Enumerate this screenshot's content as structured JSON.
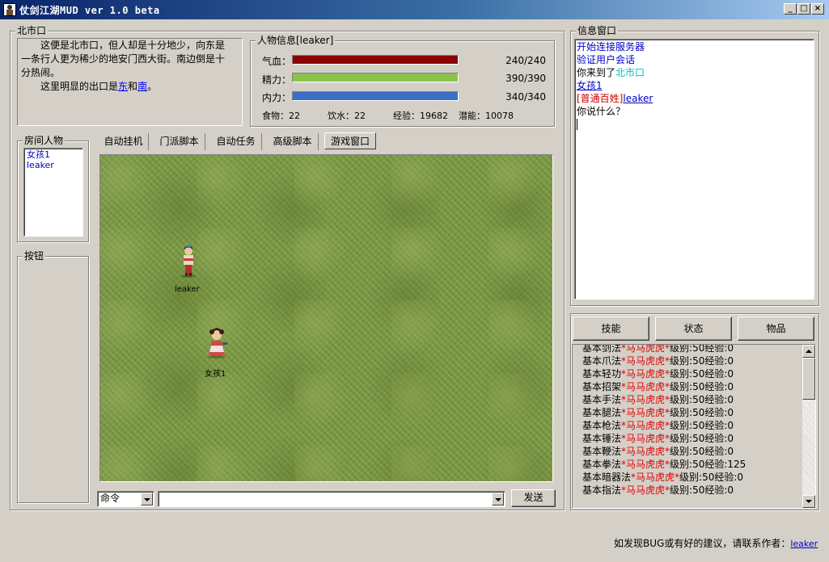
{
  "window": {
    "title": "仗剑江湖MUD ver 1.0 beta",
    "controls": {
      "minimize": "_",
      "maximize": "□",
      "close": "×"
    }
  },
  "location": {
    "title": "北市口",
    "desc_line1": "这便是北市口，但人却是十分地少，向东是一条行人更为稀少的地安门西大街。南边倒是十分热闹。",
    "exits_prefix": "这里明显的出口是",
    "exit_east": "东",
    "exits_and": "和",
    "exit_south": "南",
    "exits_suffix": "。"
  },
  "player_info": {
    "title": "人物信息[leaker]",
    "stats": [
      {
        "label": "气血：",
        "value": "240/240",
        "fill": 1.0,
        "color": "#8b0000"
      },
      {
        "label": "精力：",
        "value": "390/390",
        "fill": 1.0,
        "color": "#8bc34a"
      },
      {
        "label": "内力：",
        "value": "340/340",
        "fill": 1.0,
        "color": "#3b6fc4"
      }
    ],
    "food": "食物：22",
    "water": "饮水：22",
    "exp": "经验：19682",
    "potential": "潜能：10078"
  },
  "room_people": {
    "title": "房间人物",
    "items": [
      "女孩1",
      "leaker"
    ]
  },
  "buttons_panel": {
    "title": "按钮"
  },
  "tabs": [
    "自动挂机",
    "门派脚本",
    "自动任务",
    "高级脚本",
    "游戏窗口"
  ],
  "active_tab_index": 4,
  "game": {
    "characters": [
      {
        "name": "leaker"
      },
      {
        "name": "女孩1"
      }
    ]
  },
  "command": {
    "type_value": "命令",
    "input_value": "",
    "send_label": "发送"
  },
  "info_window": {
    "title": "信息窗口",
    "messages": {
      "m1": "开始连接服务器",
      "m2": "验证用户会话",
      "m3_prefix": "你来到了",
      "m3_place": "北市口",
      "m4": "女孩1",
      "m5_title": "[普通百姓]",
      "m5_name": "leaker",
      "m6": "你说什么？"
    }
  },
  "panel_buttons": [
    "技能",
    "状态",
    "物品"
  ],
  "skills": [
    {
      "name": "基本剑法",
      "rank": "*马马虎虎*",
      "level": "级别:50",
      "exp": "经验:0"
    },
    {
      "name": "基本爪法",
      "rank": "*马马虎虎*",
      "level": "级别:50",
      "exp": "经验:0"
    },
    {
      "name": "基本轻功",
      "rank": "*马马虎虎*",
      "level": "级别:50",
      "exp": "经验:0"
    },
    {
      "name": "基本招架",
      "rank": "*马马虎虎*",
      "level": "级别:50",
      "exp": "经验:0"
    },
    {
      "name": "基本手法",
      "rank": "*马马虎虎*",
      "level": "级别:50",
      "exp": "经验:0"
    },
    {
      "name": "基本腿法",
      "rank": "*马马虎虎*",
      "level": "级别:50",
      "exp": "经验:0"
    },
    {
      "name": "基本枪法",
      "rank": "*马马虎虎*",
      "level": "级别:50",
      "exp": "经验:0"
    },
    {
      "name": "基本锤法",
      "rank": "*马马虎虎*",
      "level": "级别:50",
      "exp": "经验:0"
    },
    {
      "name": "基本鞭法",
      "rank": "*马马虎虎*",
      "level": "级别:50",
      "exp": "经验:0"
    },
    {
      "name": "基本拳法",
      "rank": "*马马虎虎*",
      "level": "级别:50",
      "exp": "经验:125"
    },
    {
      "name": "基本暗器法",
      "rank": "*马马虎虎*",
      "level": "级别:50",
      "exp": "经验:0"
    },
    {
      "name": "基本指法",
      "rank": "*马马虎虎*",
      "level": "级别:50",
      "exp": "经验:0"
    }
  ],
  "footer": {
    "text": "如发现BUG或有好的建议，请联系作者：",
    "author": "leaker"
  }
}
